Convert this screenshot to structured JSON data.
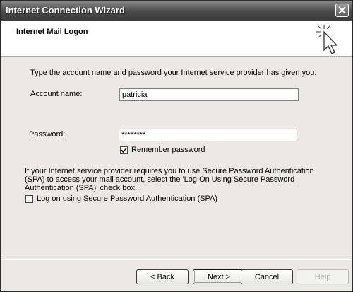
{
  "window": {
    "title": "Internet Connection Wizard"
  },
  "header": {
    "title": "Internet Mail Logon"
  },
  "intro": "Type the account name and password your Internet service provider has given you.",
  "account": {
    "label": "Account name:",
    "value": "patricia"
  },
  "password": {
    "label": "Password:",
    "value": "********"
  },
  "remember": {
    "label": "Remember password",
    "checked": true
  },
  "spa_info": {
    "line1": "If your Internet service provider requires you to use Secure Password Authentication",
    "line2": "(SPA) to access your mail account, select the 'Log On Using Secure Password",
    "line3": "Authentication (SPA)' check box."
  },
  "spa": {
    "label": "Log on using Secure Password Authentication (SPA)",
    "checked": false
  },
  "buttons": {
    "back": "< Back",
    "next": "Next >",
    "cancel": "Cancel",
    "help": "Help"
  },
  "icons": {
    "close": "close-icon",
    "wizard": "wizard-cursor-icon",
    "check": "check-icon"
  }
}
